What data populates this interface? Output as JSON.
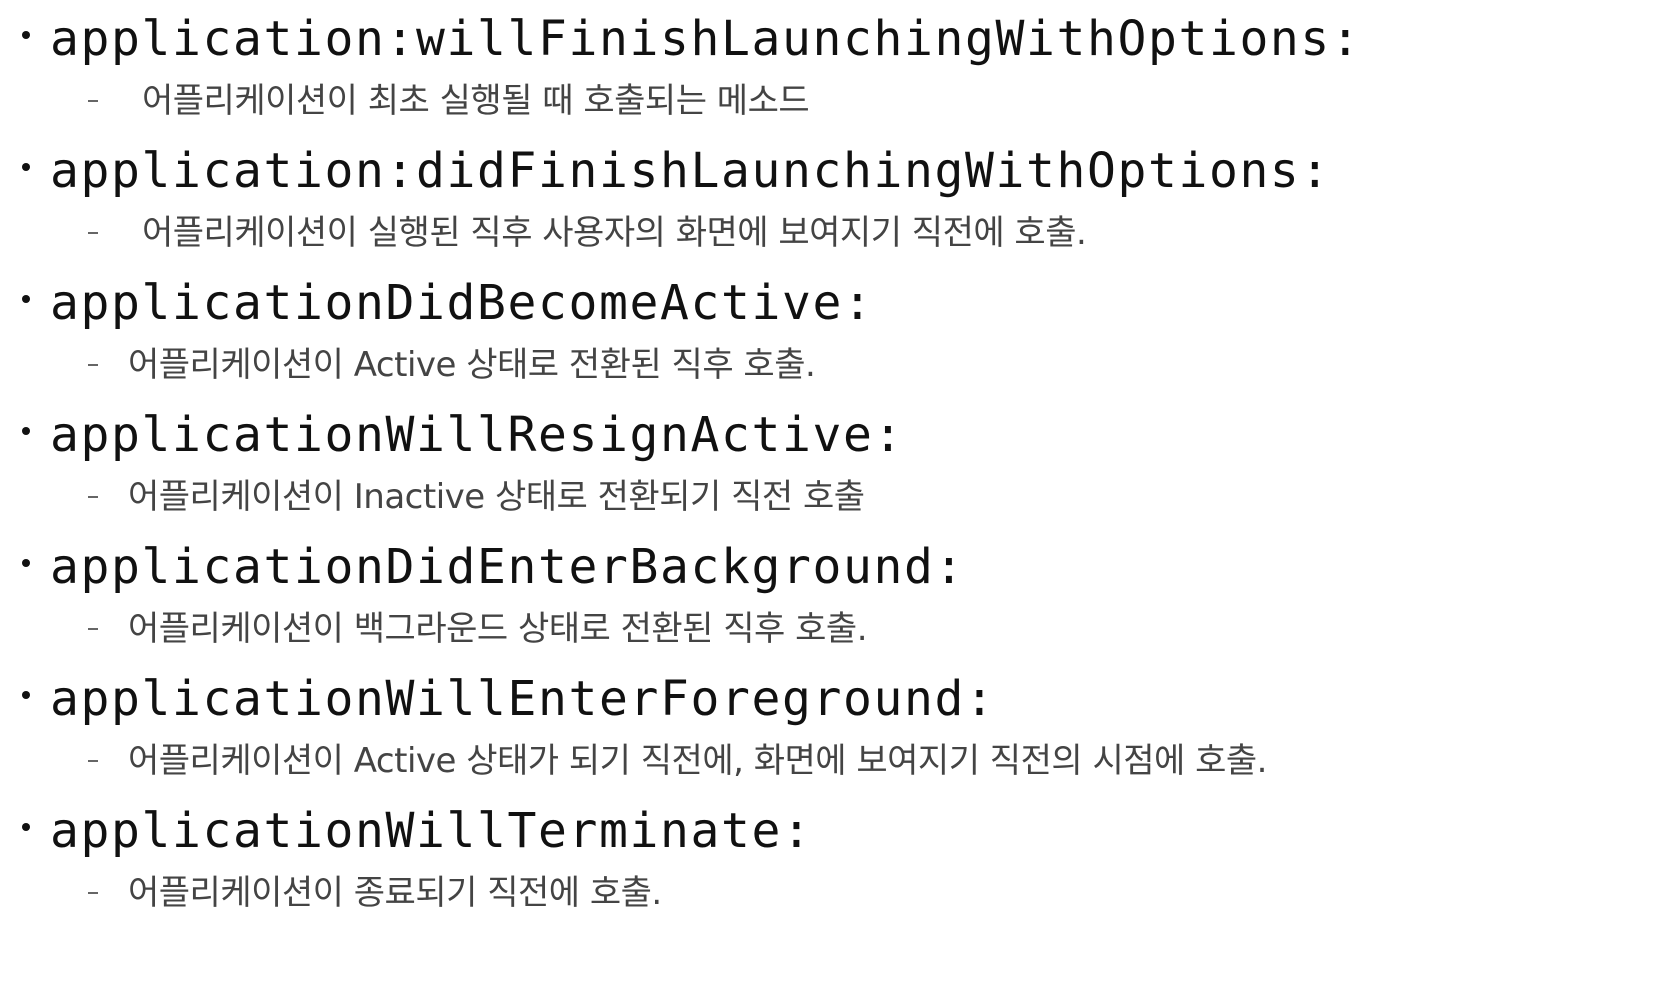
{
  "entries": [
    {
      "method": "application:willFinishLaunchingWithOptions:",
      "description": "어플리케이션이 최초 실행될 때 호출되는 메소드"
    },
    {
      "method": "application:didFinishLaunchingWithOptions:",
      "description": "어플리케이션이 실행된 직후 사용자의 화면에 보여지기 직전에 호출."
    },
    {
      "method": "applicationDidBecomeActive:",
      "description": "어플리케이션이 Active 상태로 전환된 직후 호출."
    },
    {
      "method": "applicationWillResignActive:",
      "description": "어플리케이션이 Inactive 상태로 전환되기 직전 호출"
    },
    {
      "method": "applicationDidEnterBackground:",
      "description": "어플리케이션이 백그라운드 상태로 전환된 직후 호출."
    },
    {
      "method": "applicationWillEnterForeground:",
      "description": "어플리케이션이 Active 상태가 되기 직전에, 화면에 보여지기 직전의 시점에 호출."
    },
    {
      "method": "applicationWillTerminate:",
      "description": "어플리케이션이 종료되기 직전에 호출."
    }
  ]
}
